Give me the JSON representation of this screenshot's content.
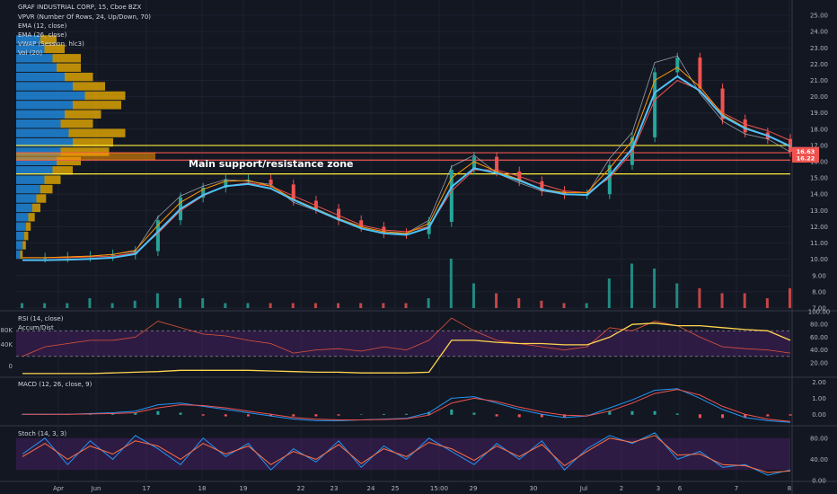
{
  "chart_data": [
    {
      "type": "line",
      "panel": "price",
      "title": "GRAF INDUSTRIAL CORP, 15, Cboe BZX",
      "indicators": [
        "VPVR (Number Of Rows, 24, Up/Down, 70)",
        "EMA (12, close)",
        "EMA (26, close)",
        "VWAP (Session, hlc3)",
        "Vol (20)"
      ],
      "ylim": [
        7.0,
        25.5
      ],
      "y_ticks": [
        "25.00",
        "24.00",
        "23.00",
        "22.00",
        "21.00",
        "20.00",
        "19.00",
        "18.00",
        "17.00",
        "16.00",
        "15.00",
        "14.00",
        "13.00",
        "12.00",
        "11.00",
        "10.00",
        "9.00",
        "8.00",
        "7.00"
      ],
      "price_badges": [
        "16.63",
        "16.22"
      ],
      "annotation": "Main support/resistance zone",
      "zone_lines": [
        17.0,
        16.55,
        16.1,
        15.25
      ],
      "x_ticks": [
        "Apr",
        "Jun",
        "17",
        "18",
        "19",
        "22",
        "23",
        "24",
        "25",
        "15:00",
        "29",
        "30",
        "Jul",
        "2",
        "3",
        "6",
        "7",
        "8"
      ],
      "close": [
        10.1,
        10.1,
        10.15,
        10.2,
        10.3,
        10.5,
        12.4,
        13.8,
        14.4,
        14.9,
        14.9,
        14.6,
        13.6,
        13.1,
        12.4,
        12.0,
        11.6,
        11.55,
        12.3,
        15.5,
        16.3,
        15.4,
        14.8,
        14.2,
        14.0,
        14.0,
        15.8,
        17.5,
        21.5,
        22.4,
        20.5,
        18.6,
        17.8,
        17.4,
        16.6
      ],
      "ema12": [
        10.1,
        10.1,
        10.15,
        10.2,
        10.3,
        10.55,
        12.1,
        13.5,
        14.3,
        14.8,
        14.85,
        14.5,
        13.7,
        13.1,
        12.5,
        12.0,
        11.7,
        11.6,
        12.2,
        15.0,
        16.0,
        15.4,
        14.9,
        14.3,
        14.1,
        14.1,
        15.6,
        17.3,
        21.0,
        21.8,
        20.6,
        18.9,
        18.1,
        17.6,
        16.9
      ],
      "ema26": [
        10.1,
        10.1,
        10.1,
        10.15,
        10.2,
        10.4,
        11.6,
        13.0,
        13.9,
        14.5,
        14.7,
        14.5,
        13.9,
        13.3,
        12.7,
        12.1,
        11.8,
        11.7,
        12.0,
        14.2,
        15.5,
        15.5,
        15.1,
        14.6,
        14.2,
        14.1,
        15.0,
        16.6,
        19.8,
        21.0,
        20.4,
        19.0,
        18.3,
        17.9,
        17.3
      ],
      "vwap": [
        10.1,
        10.1,
        10.15,
        10.2,
        10.3,
        10.5,
        12.6,
        13.9,
        14.5,
        14.9,
        14.8,
        14.6,
        13.5,
        13.0,
        12.4,
        11.9,
        11.6,
        11.6,
        12.4,
        15.7,
        16.4,
        15.3,
        14.7,
        14.2,
        14.0,
        14.0,
        16.2,
        17.8,
        22.1,
        22.5,
        20.2,
        18.5,
        17.7,
        17.4,
        16.6
      ]
    },
    {
      "type": "bar",
      "panel": "volume",
      "values": [
        0.1,
        0.1,
        0.1,
        0.2,
        0.1,
        0.15,
        0.3,
        0.2,
        0.2,
        0.1,
        0.1,
        0.1,
        0.1,
        0.1,
        0.1,
        0.1,
        0.1,
        0.1,
        0.2,
        1.0,
        0.5,
        0.3,
        0.2,
        0.15,
        0.1,
        0.1,
        0.6,
        0.9,
        0.8,
        0.5,
        0.4,
        0.3,
        0.3,
        0.2,
        0.4
      ]
    },
    {
      "type": "line",
      "panel": "rsi",
      "title": "RSI (14, close)",
      "secondary": "Accum/Dist",
      "ylim": [
        0,
        100
      ],
      "y_ticks": [
        "100.00",
        "80.00",
        "60.00",
        "40.00",
        "20.00"
      ],
      "left_ticks": [
        "80K",
        "40K",
        "0"
      ],
      "rsi": [
        30,
        45,
        50,
        55,
        55,
        60,
        85,
        75,
        65,
        62,
        55,
        50,
        35,
        40,
        42,
        38,
        45,
        40,
        55,
        90,
        70,
        55,
        50,
        45,
        40,
        45,
        75,
        70,
        85,
        78,
        60,
        45,
        42,
        40,
        35
      ],
      "accum_dist": [
        3,
        3,
        3,
        3,
        4,
        5,
        6,
        8,
        8,
        8,
        8,
        7,
        6,
        5,
        5,
        4,
        4,
        4,
        5,
        55,
        55,
        52,
        50,
        50,
        48,
        48,
        60,
        80,
        82,
        78,
        78,
        75,
        72,
        70,
        55
      ]
    },
    {
      "type": "line",
      "panel": "macd",
      "title": "MACD (12, 26, close, 9)",
      "ylim": [
        -0.6,
        2.2
      ],
      "y_ticks": [
        "2.00",
        "1.00",
        "0.00"
      ],
      "macd": [
        0,
        0,
        0,
        0.05,
        0.1,
        0.2,
        0.6,
        0.7,
        0.5,
        0.3,
        0.1,
        -0.1,
        -0.3,
        -0.4,
        -0.4,
        -0.35,
        -0.3,
        -0.25,
        0.1,
        1.0,
        1.1,
        0.7,
        0.3,
        0,
        -0.2,
        -0.1,
        0.4,
        0.9,
        1.5,
        1.6,
        1.0,
        0.3,
        -0.2,
        -0.4,
        -0.5
      ],
      "signal": [
        0,
        0,
        0,
        0.02,
        0.05,
        0.1,
        0.4,
        0.6,
        0.55,
        0.4,
        0.2,
        0,
        -0.2,
        -0.3,
        -0.35,
        -0.35,
        -0.32,
        -0.28,
        -0.05,
        0.7,
        1.0,
        0.8,
        0.45,
        0.15,
        -0.05,
        -0.1,
        0.2,
        0.7,
        1.3,
        1.55,
        1.2,
        0.5,
        0,
        -0.3,
        -0.45
      ]
    },
    {
      "type": "line",
      "panel": "stoch",
      "title": "Stoch (14, 3, 3)",
      "ylim": [
        0,
        100
      ],
      "y_ticks": [
        "80.00",
        "40.00",
        "0.00"
      ],
      "k": [
        50,
        80,
        30,
        75,
        40,
        85,
        60,
        30,
        80,
        45,
        70,
        20,
        60,
        35,
        75,
        25,
        65,
        40,
        80,
        55,
        30,
        70,
        40,
        75,
        20,
        60,
        85,
        70,
        90,
        40,
        55,
        25,
        30,
        10,
        20
      ],
      "d": [
        45,
        70,
        40,
        65,
        50,
        75,
        65,
        40,
        70,
        50,
        65,
        30,
        55,
        40,
        68,
        32,
        60,
        45,
        72,
        60,
        38,
        65,
        45,
        68,
        28,
        55,
        80,
        72,
        85,
        48,
        50,
        30,
        28,
        15,
        18
      ]
    }
  ],
  "colors": {
    "background": "#131722",
    "price_candle_up": "#26a69a",
    "price_candle_down": "#ef5350",
    "ema12": "#ff9800",
    "ema26": "#ef5350",
    "vwap": "#4fc3f7",
    "vpvr_up": "#2196f3",
    "vpvr_down": "#f4b400",
    "zone_line": "#ffeb3b",
    "zone_red": "#ef5350",
    "rsi_band": "#4a1f63",
    "accum_dist": "#ffd54f",
    "macd": "#2196f3",
    "signal": "#ef5350",
    "stoch_k": "#2196f3",
    "stoch_d": "#ff7043"
  }
}
